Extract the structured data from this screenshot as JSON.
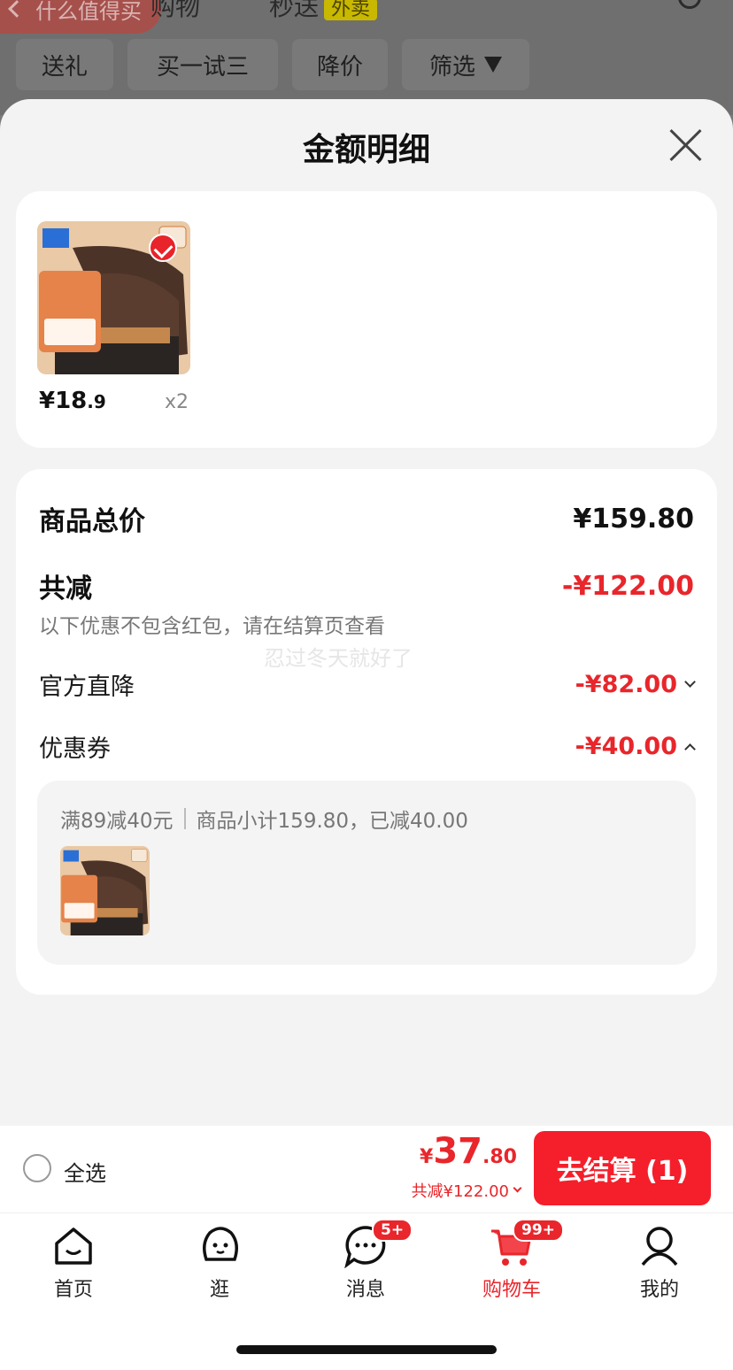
{
  "background": {
    "back_label": "什么值得买",
    "tabs": [
      "购物",
      "秒送",
      "外卖"
    ],
    "chips": [
      "送礼",
      "买一试三",
      "降价",
      "筛选"
    ]
  },
  "sheet": {
    "title": "金额明细",
    "item": {
      "price_int": "¥18",
      "price_dec": ".9",
      "qty": "x2"
    },
    "summary": {
      "total_label": "商品总价",
      "total_value": "¥159.80",
      "discount_label": "共减",
      "discount_value": "-¥122.00",
      "note": "以下优惠不包含红包，请在结算页查看",
      "watermark": "忍过冬天就好了",
      "official_label": "官方直降",
      "official_value": "-¥82.00",
      "coupon_label": "优惠券",
      "coupon_value": "-¥40.00",
      "coupon_rule": "满89减40元",
      "coupon_detail": "商品小计159.80，已减40.00"
    }
  },
  "bottom_bar": {
    "select_all": "全选",
    "total_symbol": "¥",
    "total_int": "37",
    "total_dec": ".80",
    "saved": "共减¥122.00",
    "checkout": "去结算 (1)"
  },
  "tabbar": {
    "items": [
      {
        "label": "首页"
      },
      {
        "label": "逛"
      },
      {
        "label": "消息",
        "badge": "5+"
      },
      {
        "label": "购物车",
        "badge": "99+"
      },
      {
        "label": "我的"
      }
    ]
  },
  "colors": {
    "accent": "#e8262b",
    "checkout": "#f51f2b"
  }
}
